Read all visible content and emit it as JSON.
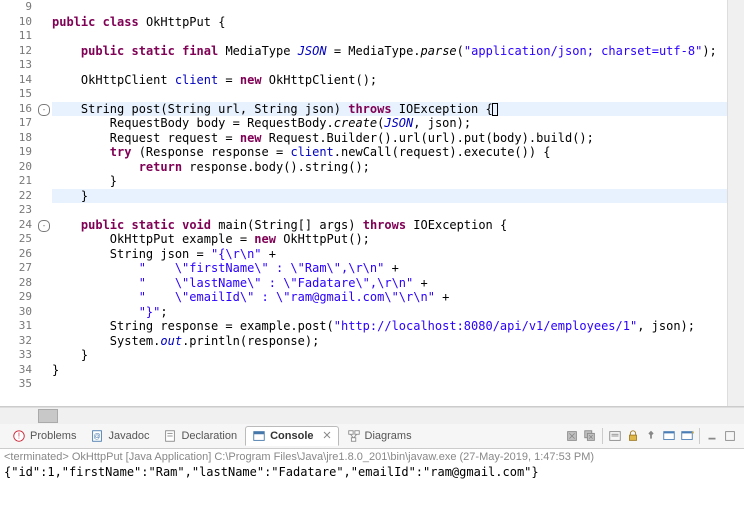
{
  "lines": [
    {
      "n": 9,
      "html": ""
    },
    {
      "n": 10,
      "html": "<span class=\"kw\">public</span> <span class=\"kw\">class</span> OkHttpPut {"
    },
    {
      "n": 11,
      "html": ""
    },
    {
      "n": 12,
      "html": "    <span class=\"kw\">public</span> <span class=\"kw\">static</span> <span class=\"kw\">final</span> MediaType <span class=\"sfld\">JSON</span> = MediaType.<span class=\"mth\">parse</span>(<span class=\"str\">\"application/json; charset=utf-8\"</span>);"
    },
    {
      "n": 13,
      "html": ""
    },
    {
      "n": 14,
      "html": "    OkHttpClient <span class=\"fld\">client</span> = <span class=\"kw\">new</span> OkHttpClient();"
    },
    {
      "n": 15,
      "html": ""
    },
    {
      "n": 16,
      "html": "    String post(String url, String json) <span class=\"kw\">throws</span> IOException {<span class=\"caret-box\"></span>",
      "marker": "⊖",
      "hl": true
    },
    {
      "n": 17,
      "html": "        RequestBody body = RequestBody.<span class=\"mth\">create</span>(<span class=\"sfld\">JSON</span>, json);"
    },
    {
      "n": 18,
      "html": "        Request request = <span class=\"kw\">new</span> Request.Builder().url(url).put(body).build();"
    },
    {
      "n": 19,
      "html": "        <span class=\"kw\">try</span> (Response response = <span class=\"fld\">client</span>.newCall(request).execute()) {"
    },
    {
      "n": 20,
      "html": "            <span class=\"kw\">return</span> response.body().string();"
    },
    {
      "n": 21,
      "html": "        }"
    },
    {
      "n": 22,
      "html": "    }",
      "hl": true
    },
    {
      "n": 23,
      "html": ""
    },
    {
      "n": 24,
      "html": "    <span class=\"kw\">public</span> <span class=\"kw\">static</span> <span class=\"kw\">void</span> main(String[] args) <span class=\"kw\">throws</span> IOException {",
      "marker": "⊖"
    },
    {
      "n": 25,
      "html": "        OkHttpPut example = <span class=\"kw\">new</span> OkHttpPut();"
    },
    {
      "n": 26,
      "html": "        String json = <span class=\"str\">\"{\\r\\n\"</span> +"
    },
    {
      "n": 27,
      "html": "            <span class=\"str\">\"    \\\"firstName\\\" : \\\"Ram\\\",\\r\\n\"</span> +"
    },
    {
      "n": 28,
      "html": "            <span class=\"str\">\"    \\\"lastName\\\" : \\\"Fadatare\\\",\\r\\n\"</span> +"
    },
    {
      "n": 29,
      "html": "            <span class=\"str\">\"    \\\"emailId\\\" : \\\"ram@gmail.com\\\"\\r\\n\"</span> +"
    },
    {
      "n": 30,
      "html": "            <span class=\"str\">\"}\"</span>;"
    },
    {
      "n": 31,
      "html": "        String response = example.post(<span class=\"str\">\"http://localhost:8080/api/v1/employees/1\"</span>, json);"
    },
    {
      "n": 32,
      "html": "        System.<span class=\"sfld\">out</span>.println(response);"
    },
    {
      "n": 33,
      "html": "    }"
    },
    {
      "n": 34,
      "html": "}"
    },
    {
      "n": 35,
      "html": ""
    }
  ],
  "views": {
    "tabs": [
      {
        "label": "Problems",
        "icon": "problems"
      },
      {
        "label": "Javadoc",
        "icon": "javadoc"
      },
      {
        "label": "Declaration",
        "icon": "declaration"
      },
      {
        "label": "Console",
        "icon": "console",
        "active": true,
        "close": true
      },
      {
        "label": "Diagrams",
        "icon": "diagrams"
      }
    ]
  },
  "console": {
    "term": "<terminated> OkHttpPut [Java Application] C:\\Program Files\\Java\\jre1.8.0_201\\bin\\javaw.exe (27-May-2019, 1:47:53 PM)",
    "out": "{\"id\":1,\"firstName\":\"Ram\",\"lastName\":\"Fadatare\",\"emailId\":\"ram@gmail.com\"}"
  }
}
